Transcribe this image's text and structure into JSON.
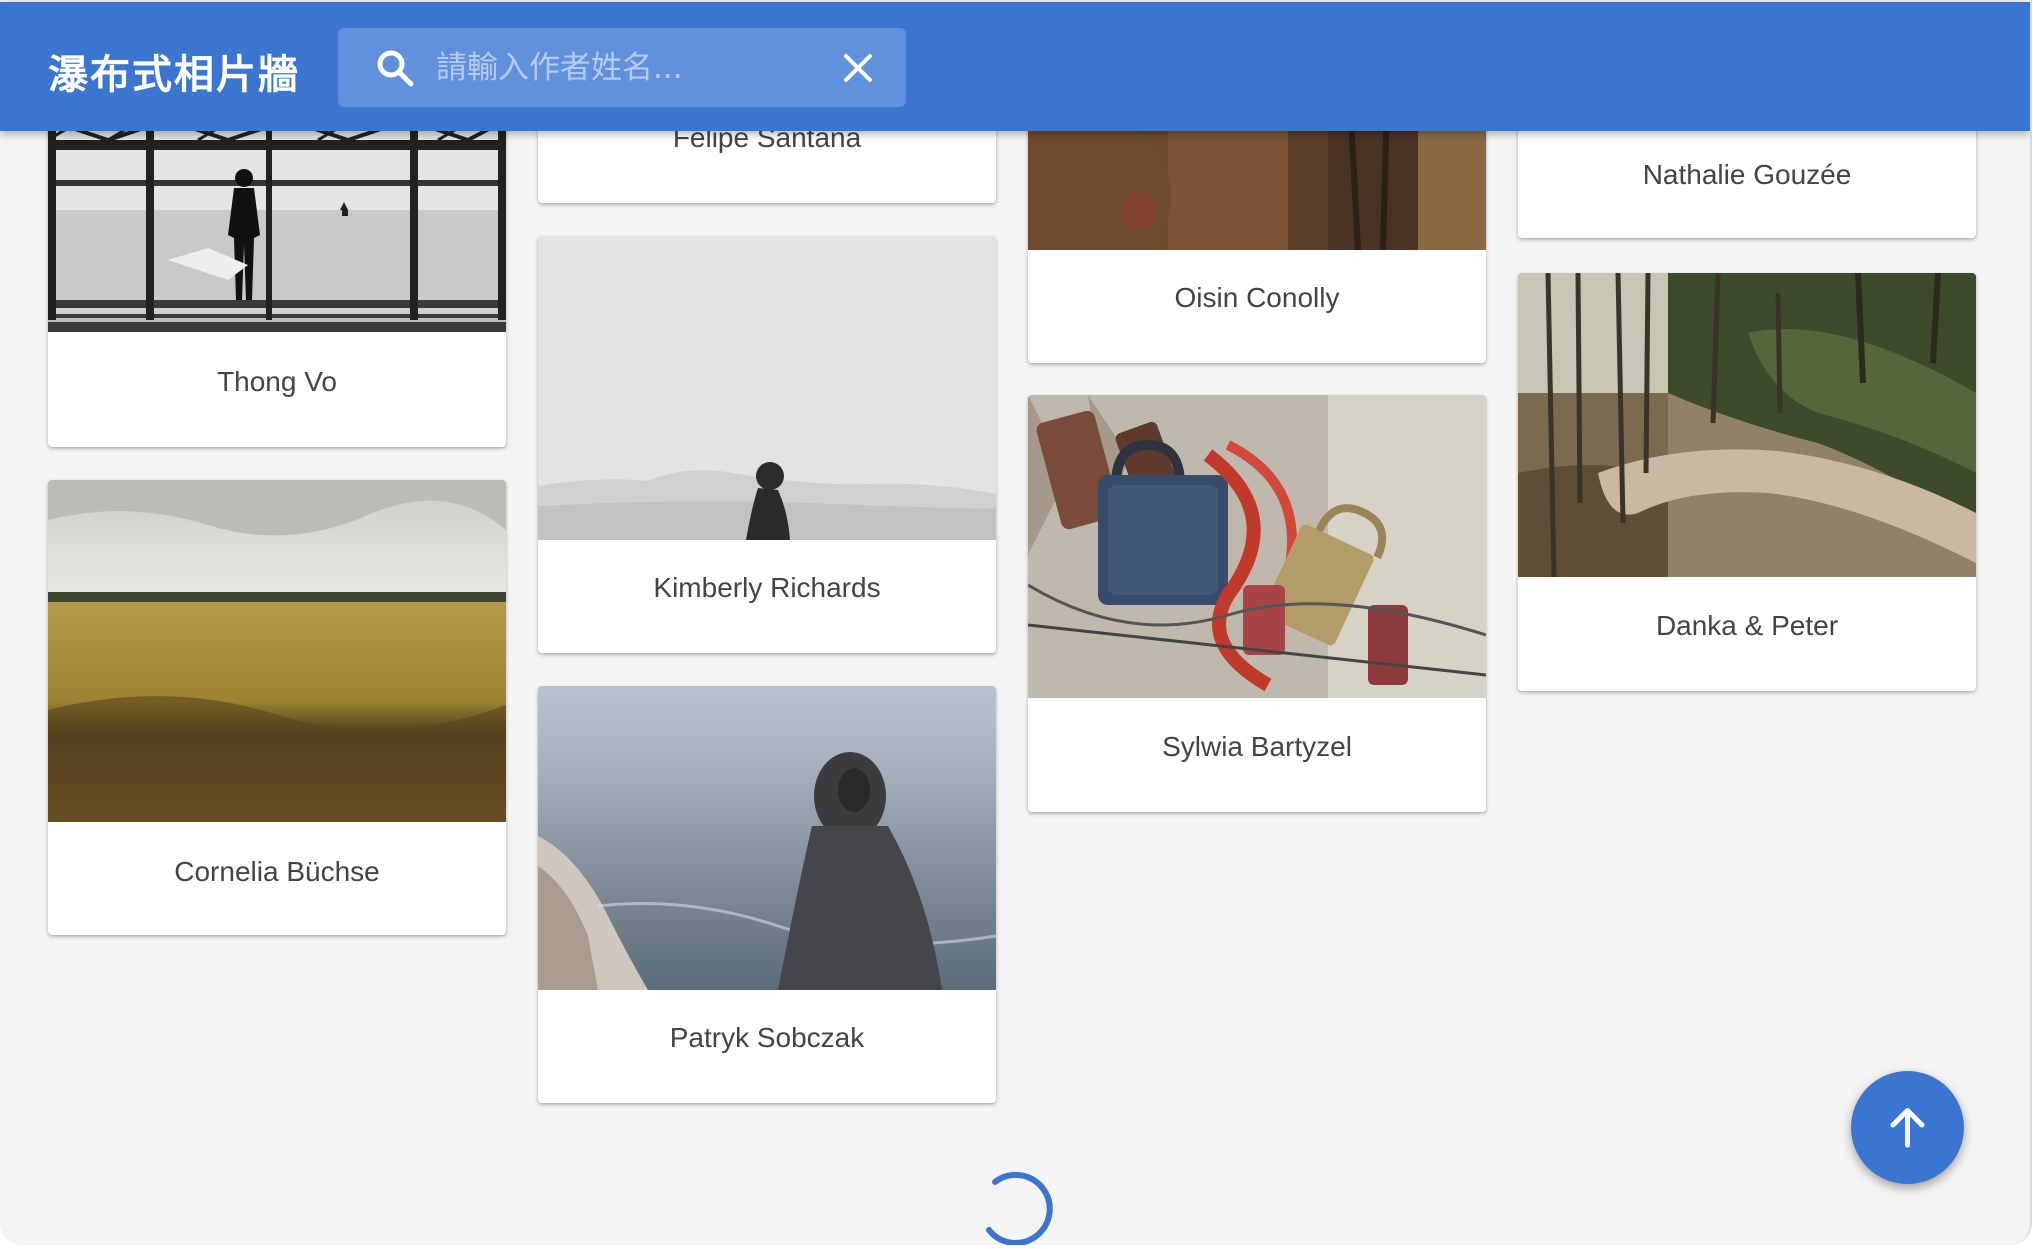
{
  "appbar": {
    "title": "瀑布式相片牆",
    "search": {
      "placeholder": "請輸入作者姓名...",
      "value": ""
    }
  },
  "cards": [
    {
      "author": "Thong Vo"
    },
    {
      "author": "Cornelia Büchse"
    },
    {
      "author": "Felipe Santana"
    },
    {
      "author": "Kimberly Richards"
    },
    {
      "author": "Patryk Sobczak"
    },
    {
      "author": "Oisin Conolly"
    },
    {
      "author": "Sylwia Bartyzel"
    },
    {
      "author": "Nathalie Gouzée"
    },
    {
      "author": "Danka & Peter"
    }
  ],
  "icons": {
    "search": "search-icon",
    "clear": "close-icon",
    "scroll_top": "arrow-up-icon",
    "loading": "loading-spinner"
  },
  "colors": {
    "primary": "#3a76d0",
    "background": "#f4f4f4",
    "card": "#ffffff"
  }
}
